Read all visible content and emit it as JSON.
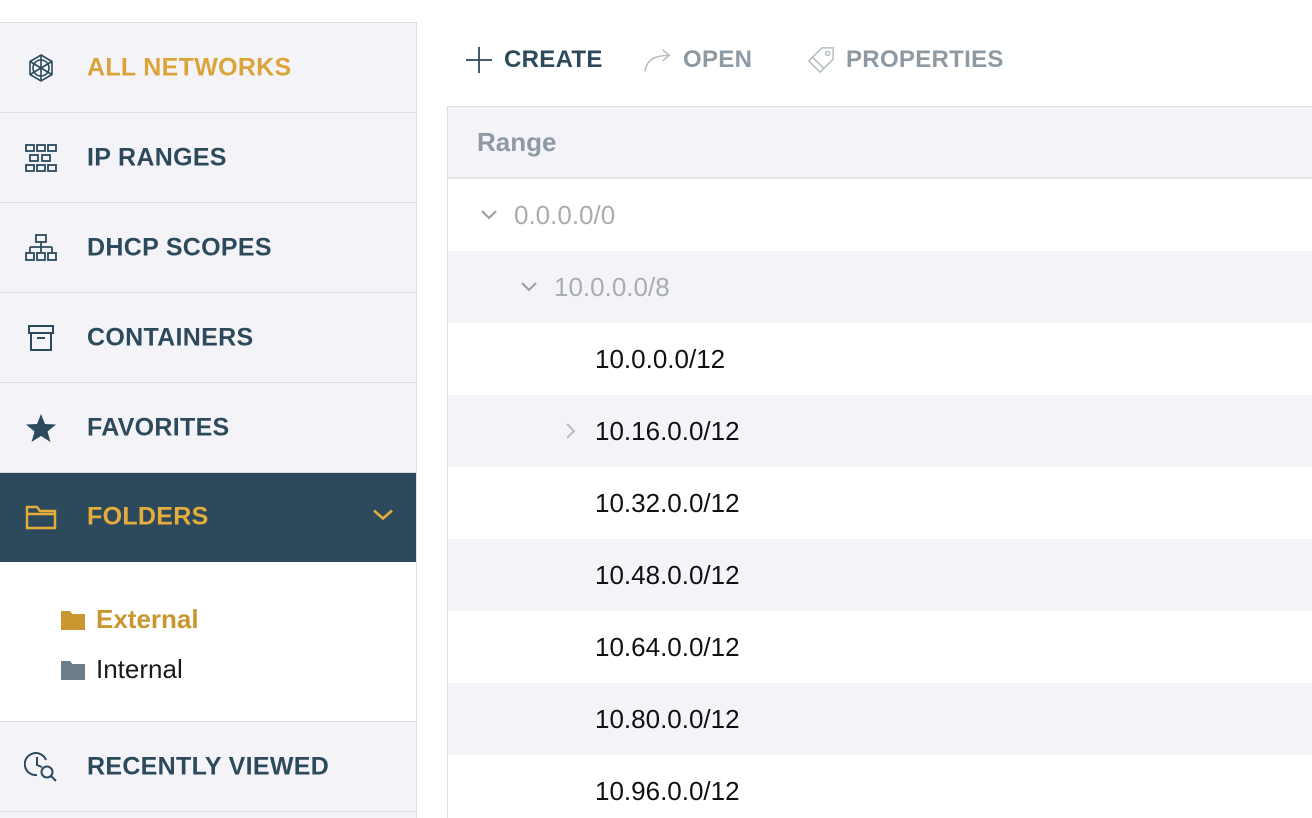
{
  "sidebar": {
    "items": [
      {
        "label": "ALL NETWORKS",
        "icon": "network-globe-icon"
      },
      {
        "label": "IP RANGES",
        "icon": "ip-ranges-grid-icon"
      },
      {
        "label": "DHCP SCOPES",
        "icon": "hierarchy-icon"
      },
      {
        "label": "CONTAINERS",
        "icon": "archive-box-icon"
      },
      {
        "label": "FAVORITES",
        "icon": "star-icon"
      },
      {
        "label": "FOLDERS",
        "icon": "folder-outline-icon"
      },
      {
        "label": "RECENTLY VIEWED",
        "icon": "clock-search-icon"
      }
    ],
    "folders": [
      {
        "label": "External",
        "selected": true
      },
      {
        "label": "Internal",
        "selected": false
      }
    ]
  },
  "toolbar": {
    "create_label": "CREATE",
    "open_label": "OPEN",
    "properties_label": "PROPERTIES"
  },
  "grid": {
    "column_header": "Range",
    "rows": [
      {
        "text": "0.0.0.0/0",
        "level": 0,
        "expander": "expanded"
      },
      {
        "text": "10.0.0.0/8",
        "level": 1,
        "expander": "expanded"
      },
      {
        "text": "10.0.0.0/12",
        "level": 2,
        "expander": "none"
      },
      {
        "text": "10.16.0.0/12",
        "level": 2,
        "expander": "collapsed"
      },
      {
        "text": "10.32.0.0/12",
        "level": 2,
        "expander": "none"
      },
      {
        "text": "10.48.0.0/12",
        "level": 2,
        "expander": "none"
      },
      {
        "text": "10.64.0.0/12",
        "level": 2,
        "expander": "none"
      },
      {
        "text": "10.80.0.0/12",
        "level": 2,
        "expander": "none"
      },
      {
        "text": "10.96.0.0/12",
        "level": 2,
        "expander": "none"
      }
    ]
  },
  "colors": {
    "brand_dark": "#2c4a5c",
    "accent_gold": "#dba43a",
    "sidebar_bg": "#f4f4f8",
    "disabled_text": "#8e9aa3"
  }
}
